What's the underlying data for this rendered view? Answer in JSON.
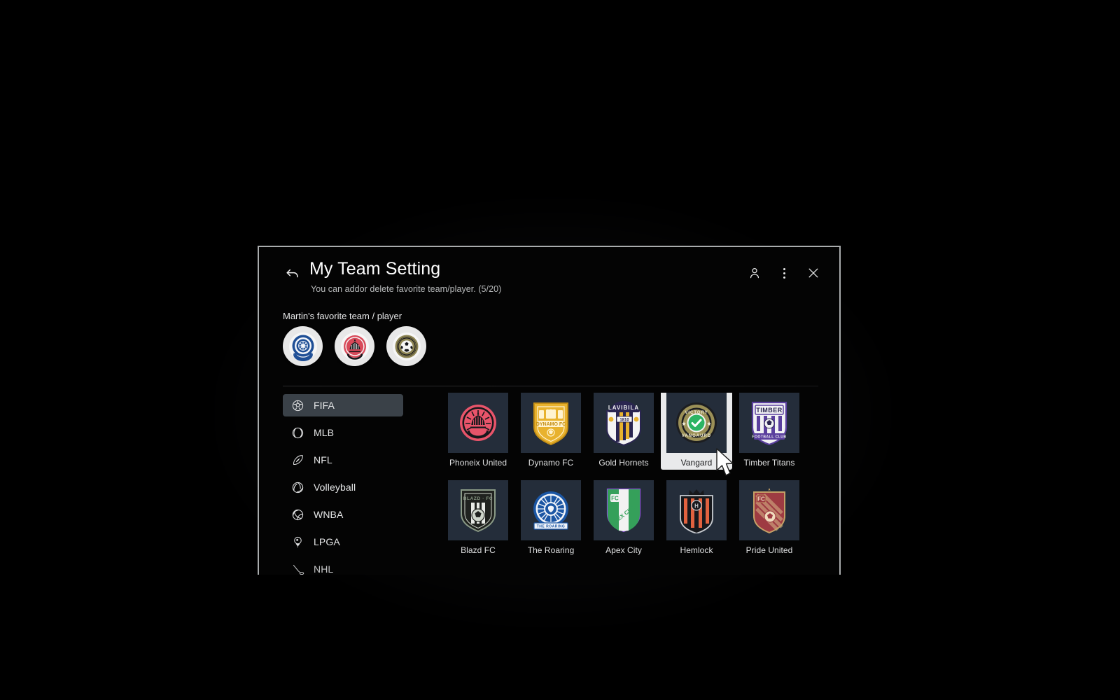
{
  "header": {
    "title": "My Team Setting",
    "subtitle": "You can addor delete favorite team/player. (5/20)",
    "back_icon": "back-arrow-icon",
    "profile_icon": "person-icon",
    "menu_icon": "more-options-icon",
    "close_icon": "close-icon"
  },
  "favorites": {
    "label": "Martin's favorite team / player",
    "items": [
      {
        "name": "blue-crest-badge",
        "color": "#1f4f96"
      },
      {
        "name": "red-black-crest-badge",
        "color": "#d84a5a"
      },
      {
        "name": "gold-soccer-badge",
        "color": "#8d8452"
      }
    ]
  },
  "sidebar": {
    "items": [
      {
        "label": "FIFA",
        "icon": "soccer-ball-icon",
        "active": true
      },
      {
        "label": "MLB",
        "icon": "baseball-icon",
        "active": false
      },
      {
        "label": "NFL",
        "icon": "football-icon",
        "active": false
      },
      {
        "label": "Volleyball",
        "icon": "volleyball-icon",
        "active": false
      },
      {
        "label": "WNBA",
        "icon": "basketball-icon",
        "active": false
      },
      {
        "label": "LPGA",
        "icon": "golf-ball-tee-icon",
        "active": false
      },
      {
        "label": "NHL",
        "icon": "hockey-icon",
        "active": false
      }
    ]
  },
  "teams": [
    {
      "name": "Phoneix United",
      "crest": "phoenix-crest",
      "selected": false
    },
    {
      "name": "Dynamo FC",
      "crest": "dynamo-shield",
      "selected": false
    },
    {
      "name": "Gold Hornets",
      "crest": "lavibila-shield",
      "selected": false
    },
    {
      "name": "Vangard",
      "crest": "victory-vanguard-medal",
      "selected": true
    },
    {
      "name": "Timber Titans",
      "crest": "timber-shield",
      "selected": false
    },
    {
      "name": "Blazd FC",
      "crest": "blazd-shield",
      "selected": false
    },
    {
      "name": "The Roaring",
      "crest": "roaring-lion-circle",
      "selected": false
    },
    {
      "name": "Apex City",
      "crest": "apex-city-shield",
      "selected": false
    },
    {
      "name": "Hemlock",
      "crest": "hemlock-crown-shield",
      "selected": false
    },
    {
      "name": "Pride United",
      "crest": "pride-united-shield",
      "selected": false
    }
  ],
  "colors": {
    "selected_frame": "#e9eaeb",
    "tile_bg": "#242d3a",
    "sidebar_active": "#3a4148",
    "window_border": "#a9acad"
  }
}
